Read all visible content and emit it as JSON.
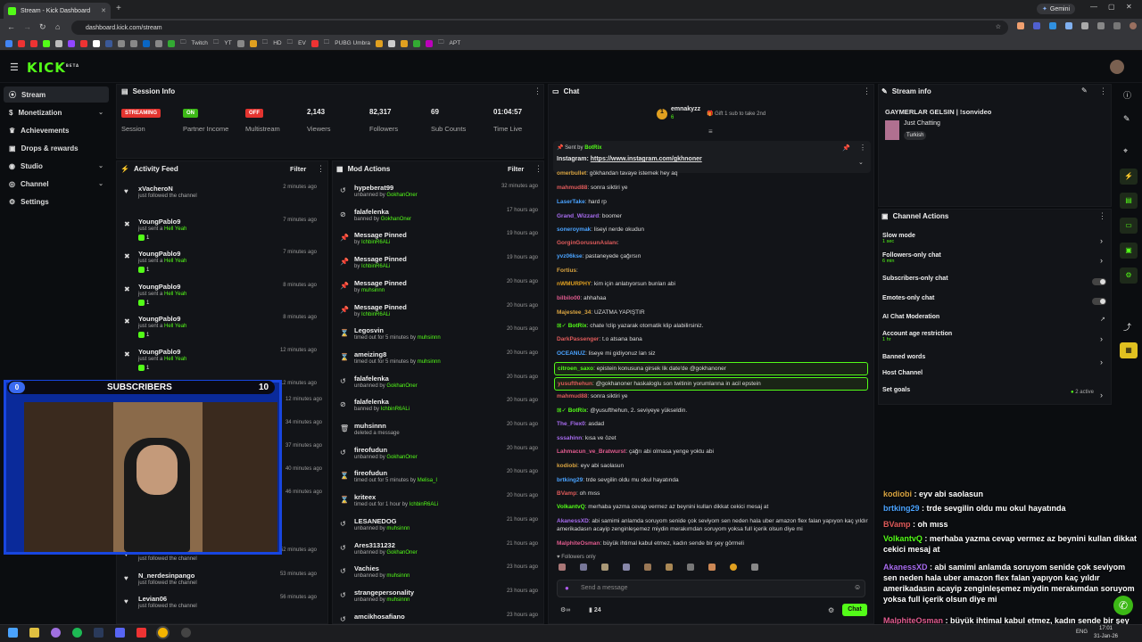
{
  "browser": {
    "tab_title": "Stream - Kick Dashboard",
    "url": "dashboard.kick.com/stream",
    "gemini_label": "Gemini",
    "bookmarks": [
      "Twitch",
      "YT",
      "HD",
      "EV",
      "PUBG Umbra",
      "APT"
    ]
  },
  "kick": {
    "logo": "KICK",
    "logo_sup": "BETA"
  },
  "sidebar": {
    "items": [
      {
        "label": "Stream",
        "icon": "signal-icon"
      },
      {
        "label": "Monetization",
        "icon": "dollar-icon"
      },
      {
        "label": "Achievements",
        "icon": "trophy-icon"
      },
      {
        "label": "Drops & rewards",
        "icon": "gift-icon"
      },
      {
        "label": "Studio",
        "icon": "studio-icon"
      },
      {
        "label": "Channel",
        "icon": "channel-icon"
      },
      {
        "label": "Settings",
        "icon": "gear-icon"
      }
    ]
  },
  "session": {
    "title": "Session Info",
    "stats": [
      {
        "value": "STREAMING",
        "label": "Session",
        "color": "#e3342f"
      },
      {
        "value": "ON",
        "label": "Partner Income",
        "color": "#3cb816"
      },
      {
        "value": "OFF",
        "label": "Multistream",
        "color": "#e3342f"
      },
      {
        "value": "2,143",
        "label": "Viewers"
      },
      {
        "value": "82,317",
        "label": "Followers"
      },
      {
        "value": "69",
        "label": "Sub Counts"
      },
      {
        "value": "01:04:57",
        "label": "Time Live"
      }
    ]
  },
  "activity": {
    "title": "Activity Feed",
    "filter": "Filter",
    "rows": [
      {
        "name": "xVacheroN",
        "sub": "just followed the channel",
        "gift": "",
        "count": "",
        "time": "2 minutes ago"
      },
      {
        "name": "YoungPablo9",
        "sub": "just sent a ",
        "gift": "Hell Yeah",
        "count": "1",
        "time": "7 minutes ago"
      },
      {
        "name": "YoungPablo9",
        "sub": "just sent a ",
        "gift": "Hell Yeah",
        "count": "1",
        "time": "7 minutes ago"
      },
      {
        "name": "YoungPablo9",
        "sub": "just sent a ",
        "gift": "Hell Yeah",
        "count": "1",
        "time": "8 minutes ago"
      },
      {
        "name": "YoungPablo9",
        "sub": "just sent a ",
        "gift": "Hell Yeah",
        "count": "1",
        "time": "8 minutes ago"
      },
      {
        "name": "YoungPablo9",
        "sub": "just sent a ",
        "gift": "Hell Yeah",
        "count": "1",
        "time": "12 minutes ago"
      },
      {
        "name": "YoungPablo9",
        "sub": "just followed the channel",
        "gift": "",
        "count": "",
        "time": "12 minutes ago"
      }
    ],
    "bottom_rows": [
      {
        "name": "",
        "sub": "just followed the channel",
        "time": "52 minutes ago"
      },
      {
        "name": "N_nerdesinpango",
        "sub": "just followed the channel",
        "time": "53 minutes ago"
      },
      {
        "name": "Levian06",
        "sub": "just followed the channel",
        "time": "56 minutes ago"
      }
    ],
    "hidden_times": [
      "12 minutes ago",
      "34 minutes ago",
      "37 minutes ago",
      "40 minutes ago",
      "46 minutes ago"
    ]
  },
  "modactions": {
    "title": "Mod Actions",
    "filter": "Filter",
    "rows": [
      {
        "name": "hypeberat99",
        "act": "unbanned by ",
        "by": "GokhanOner",
        "time": "32 minutes ago",
        "icon": "undo-icon"
      },
      {
        "name": "falafelenka",
        "act": "banned by ",
        "by": "GokhanOner",
        "time": "17 hours ago",
        "icon": "ban-icon"
      },
      {
        "name": "Message Pinned",
        "act": "by ",
        "by": "IchbinR6ALi",
        "time": "19 hours ago",
        "icon": "pin-icon"
      },
      {
        "name": "Message Pinned",
        "act": "by ",
        "by": "IchbinR6ALi",
        "time": "19 hours ago",
        "icon": "pin-icon"
      },
      {
        "name": "Message Pinned",
        "act": "by ",
        "by": "muhsinnn",
        "time": "20 hours ago",
        "icon": "pin-icon"
      },
      {
        "name": "Message Pinned",
        "act": "by ",
        "by": "IchbinR6ALi",
        "time": "20 hours ago",
        "icon": "pin-icon"
      },
      {
        "name": "Legosvin",
        "act": "timed out for 5 minutes by ",
        "by": "muhsinnn",
        "time": "20 hours ago",
        "icon": "hourglass-icon"
      },
      {
        "name": "ameizing8",
        "act": "timed out for 5 minutes by ",
        "by": "muhsinnn",
        "time": "20 hours ago",
        "icon": "hourglass-icon"
      },
      {
        "name": "falafelenka",
        "act": "unbanned by ",
        "by": "GokhanOner",
        "time": "20 hours ago",
        "icon": "undo-icon"
      },
      {
        "name": "falafelenka",
        "act": "banned by ",
        "by": "IchbinR6ALi",
        "time": "20 hours ago",
        "icon": "ban-icon"
      },
      {
        "name": "muhsinnn",
        "act": "deleted a message",
        "by": "",
        "time": "20 hours ago",
        "icon": "trash-icon"
      },
      {
        "name": "fireofudun",
        "act": "unbanned by ",
        "by": "GokhanOner",
        "time": "20 hours ago",
        "icon": "undo-icon"
      },
      {
        "name": "fireofudun",
        "act": "timed out for 5 minutes by ",
        "by": "Melisa_I",
        "time": "20 hours ago",
        "icon": "hourglass-icon"
      },
      {
        "name": "kriteex",
        "act": "timed out for 1 hour by ",
        "by": "IchbinR6ALi",
        "time": "20 hours ago",
        "icon": "hourglass-icon"
      },
      {
        "name": "LESANEDOG",
        "act": "unbanned by ",
        "by": "muhsinnn",
        "time": "21 hours ago",
        "icon": "undo-icon"
      },
      {
        "name": "Ares3131232",
        "act": "unbanned by ",
        "by": "GokhanOner",
        "time": "21 hours ago",
        "icon": "undo-icon"
      },
      {
        "name": "Vachies",
        "act": "unbanned by ",
        "by": "muhsinnn",
        "time": "23 hours ago",
        "icon": "undo-icon"
      },
      {
        "name": "strangepersonality",
        "act": "unbanned by ",
        "by": "muhsinnn",
        "time": "23 hours ago",
        "icon": "undo-icon"
      },
      {
        "name": "amcikhosafiano",
        "act": "",
        "by": "",
        "time": "23 hours ago",
        "icon": "undo-icon"
      }
    ]
  },
  "chat": {
    "title": "Chat",
    "top_gifter": {
      "name": "emnakyzz",
      "count": "6",
      "cta": "Gift 1 sub to take 2nd"
    },
    "pinned": {
      "sent_by": "Sent by",
      "author": "BotRix",
      "text": "Instagram: ",
      "link": "https://www.instagram.com/gkhnoner"
    },
    "messages": [
      {
        "user": "omerbullet",
        "color": "#d9a441",
        "text": "gökhandan tavaye istemek hey aq",
        "hl": false
      },
      {
        "user": "mahmud88",
        "color": "#e05b5b",
        "text": "sonra siktiri ye",
        "hl": false
      },
      {
        "user": "LaserTake",
        "color": "#4aa3ff",
        "text": "hard rp",
        "hl": false
      },
      {
        "user": "Grand_Wizzard",
        "color": "#a86cf0",
        "text": "boomer",
        "hl": false
      },
      {
        "user": "soneroymak",
        "color": "#4aa3ff",
        "text": "liseyi nerde okudun",
        "hl": false
      },
      {
        "user": "GorginGorusunAslanı",
        "color": "#e05b5b",
        "text": "",
        "hl": false
      },
      {
        "user": "yvz06kse",
        "color": "#4aa3ff",
        "text": "pastaneyede çağırsın",
        "hl": false
      },
      {
        "user": "Fortius",
        "color": "#d9a441",
        "text": "",
        "hl": false
      },
      {
        "user": "nWMURPHY",
        "color": "#e0a020",
        "text": "kim için anlatıyorsun bunları abi",
        "hl": false
      },
      {
        "user": "bilbilo00",
        "color": "#e05b8e",
        "text": "ahhahaa",
        "hl": false
      },
      {
        "user": "Majestee_34",
        "color": "#d9a441",
        "text": "UZATMA YAPIŞTIR",
        "hl": false
      },
      {
        "user": "BotRix",
        "color": "#53fc18",
        "text": "chate !clip yazarak otomatik klip alabilirsiniz.",
        "hl": false
      },
      {
        "user": "DarkPassenger",
        "color": "#e05b5b",
        "text": "t.o atsana bana",
        "hl": false
      },
      {
        "user": "OCEANUZ",
        "color": "#4aa3ff",
        "text": "liseye mi gidiyonuz lan siz",
        "hl": false
      },
      {
        "user": "citroen_saxo",
        "color": "#53fc18",
        "text": "epistein konusuna girsek lik date'de @gokhanoner",
        "hl": true
      },
      {
        "user": "yusufthehun",
        "color": "#e05b5b",
        "text": "@gokhanoner haskaloglu son twitinin yorumlarına in acil epstein",
        "hl": true
      },
      {
        "user": "mahmud88",
        "color": "#e05b5b",
        "text": "sonra siktiri ye",
        "hl": false
      },
      {
        "user": "BotRix",
        "color": "#53fc18",
        "text": "@yusufthehun, 2. seviyeye yükseldin.",
        "hl": false
      },
      {
        "user": "The_Flex0",
        "color": "#a86cf0",
        "text": "asdad",
        "hl": false
      },
      {
        "user": "sssahinn",
        "color": "#a86cf0",
        "text": "kısa ve özet",
        "hl": false
      },
      {
        "user": "Lahmacun_ve_Bratwurst",
        "color": "#e05b8e",
        "text": "çağrı abi olmasa yenge yoktu abi",
        "hl": false
      },
      {
        "user": "kodiobi",
        "color": "#d9a441",
        "text": "eyv abi saolasun",
        "hl": false
      },
      {
        "user": "brtking29",
        "color": "#4aa3ff",
        "text": "trde sevgilin oldu mu okul hayatında",
        "hl": false
      },
      {
        "user": "BVamp",
        "color": "#e05b5b",
        "text": "oh mıss",
        "hl": false
      },
      {
        "user": "VolkantvQ",
        "color": "#53fc18",
        "text": "merhaba yazma cevap vermez az beynini kullan dikkat cekici mesaj at",
        "hl": false
      },
      {
        "user": "AkanessXD",
        "color": "#a86cf0",
        "text": "abi samimi anlamda soruyom senide çok seviyom sen neden hala uber amazon flex falan yapıyon kaç yıldır amerikadasın acayip zenginleşemez miydin merakımdan soruyom yoksa full içerik olsun diye mi",
        "hl": false
      },
      {
        "user": "MalphiteOsman",
        "color": "#e05b8e",
        "text": "büyük ihtimal kabul etmez, kadın sende bir şey görmeli",
        "hl": false
      }
    ],
    "followers_only": "Followers only",
    "input_placeholder": "Send a message",
    "viewer_count": "24",
    "send_label": "Chat"
  },
  "streaminfo": {
    "title": "Stream info",
    "stream_title": "GAYMERLAR GELSIN | !sonvideo",
    "category": "Just Chatting",
    "tag": "Turkish"
  },
  "channel_actions": {
    "title": "Channel Actions",
    "items": [
      {
        "label": "Slow mode",
        "sub": "1 sec",
        "ctrl": "arrow"
      },
      {
        "label": "Followers-only chat",
        "sub": "6 min",
        "ctrl": "arrow"
      },
      {
        "label": "Subscribers-only chat",
        "sub": "",
        "ctrl": "toggle"
      },
      {
        "label": "Emotes-only chat",
        "sub": "",
        "ctrl": "toggle"
      },
      {
        "label": "AI Chat Moderation",
        "sub": "",
        "ctrl": "external"
      },
      {
        "label": "Account age restriction",
        "sub": "1 hr",
        "ctrl": "arrow"
      },
      {
        "label": "Banned words",
        "sub": "",
        "ctrl": "arrow"
      },
      {
        "label": "Host Channel",
        "sub": "",
        "ctrl": "none"
      },
      {
        "label": "Set goals",
        "sub": "",
        "ctrl": "goals"
      }
    ],
    "goals_status": "2 active"
  },
  "overlay": {
    "sub_goal": {
      "current": "0",
      "label": "SUBSCRIBERS",
      "target": "10"
    },
    "chat": [
      {
        "user": "kodiobi",
        "color": "#d9a441",
        "text": "eyv abi saolasun"
      },
      {
        "user": "brtking29",
        "color": "#4aa3ff",
        "text": "trde sevgilin oldu mu okul hayatında"
      },
      {
        "user": "BVamp",
        "color": "#e05b5b",
        "text": "oh mıss"
      },
      {
        "user": "VolkantvQ",
        "color": "#53fc18",
        "text": "merhaba yazma cevap vermez az beynini kullan dikkat cekici mesaj at"
      },
      {
        "user": "AkanessXD",
        "color": "#a86cf0",
        "text": "abi samimi anlamda soruyom senide çok seviyom sen neden hala uber amazon flex falan yapıyon kaç yıldır amerikadasın acayip zenginleşemez miydin merakımdan soruyom yoksa full içerik olsun diye mi"
      },
      {
        "user": "MalphiteOsman",
        "color": "#e05b8e",
        "text": "büyük ihtimal kabul etmez, kadın sende bir şey görmeli"
      }
    ]
  },
  "taskbar": {
    "lang": "ENG",
    "time": "17:01",
    "date": "31-Jan-26"
  }
}
